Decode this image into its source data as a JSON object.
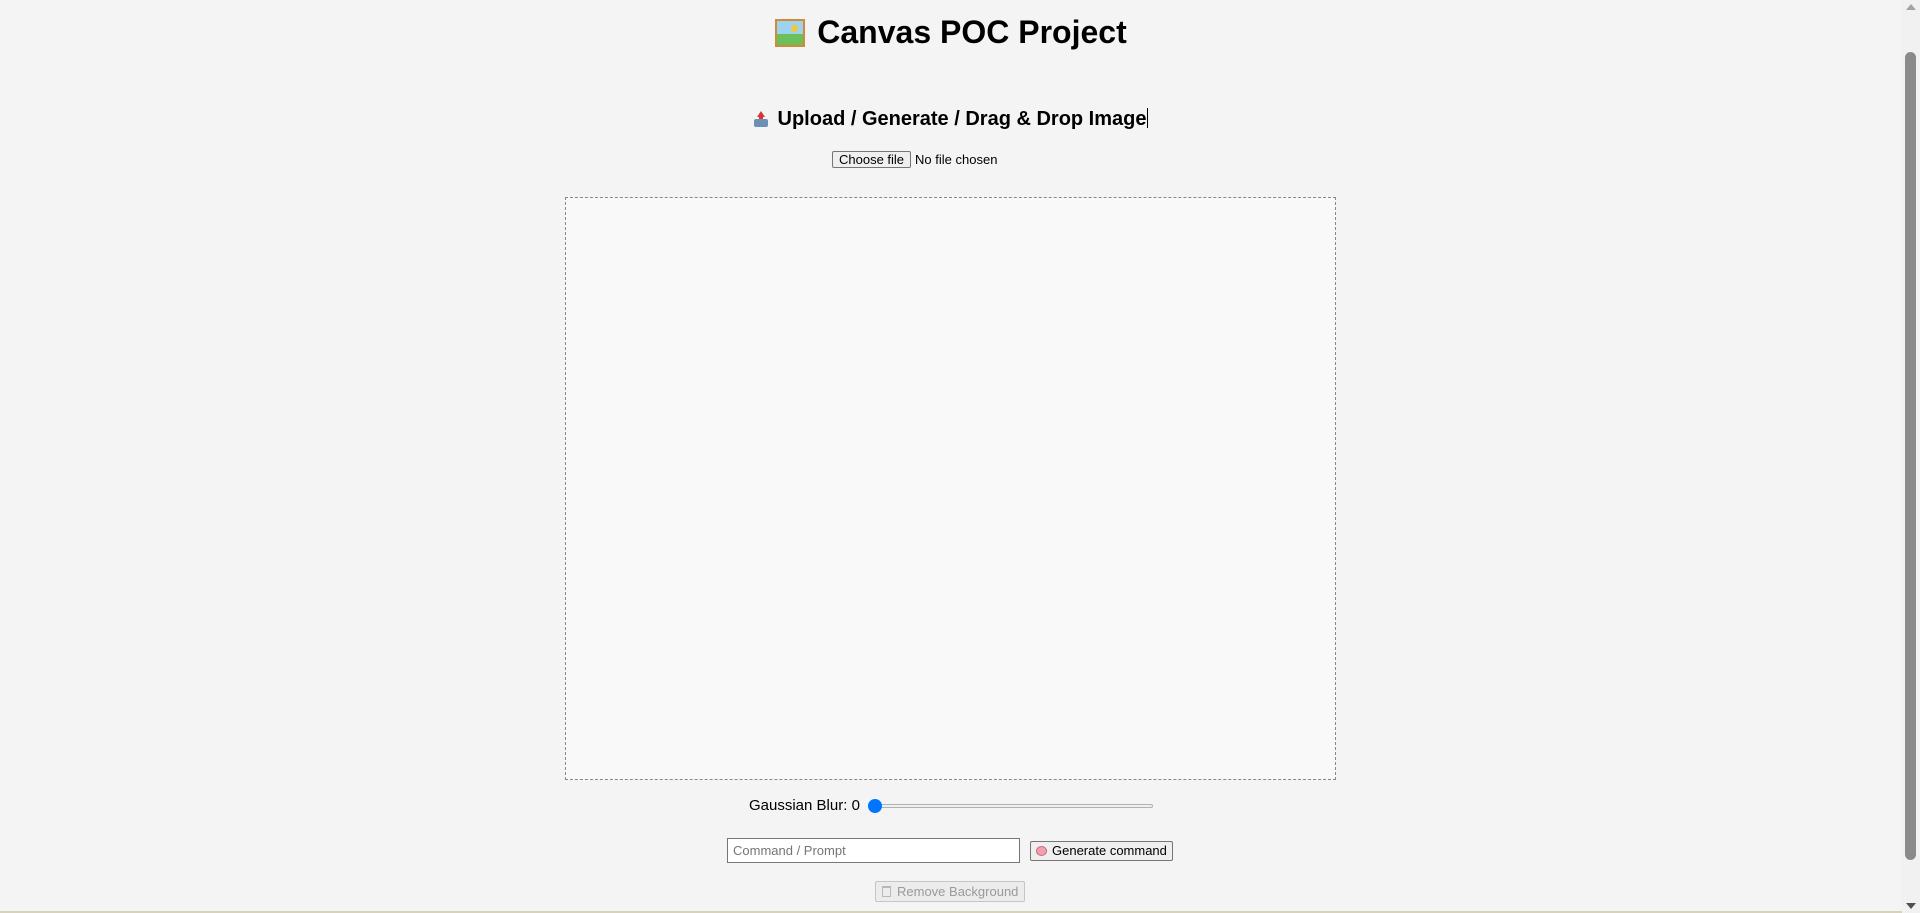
{
  "header": {
    "title": "Canvas POC Project",
    "title_icon": "framed-picture-icon"
  },
  "upload": {
    "heading": "Upload / Generate / Drag & Drop Image",
    "heading_icon": "inbox-tray-upload-icon",
    "file_button_label": "Choose file",
    "file_status": "No file chosen"
  },
  "controls": {
    "blur_label": "Gaussian Blur:",
    "blur_value": "0",
    "blur_min": "0",
    "blur_level": 0,
    "command_placeholder": "Command / Prompt",
    "command_value": "",
    "generate_label": "Generate command",
    "generate_icon": "brain-icon",
    "remove_bg_label": "Remove Background",
    "remove_bg_icon": "wastebasket-icon",
    "remove_bg_disabled": true
  },
  "colors": {
    "accent": "#0075ff",
    "background": "#f4f4f4"
  }
}
